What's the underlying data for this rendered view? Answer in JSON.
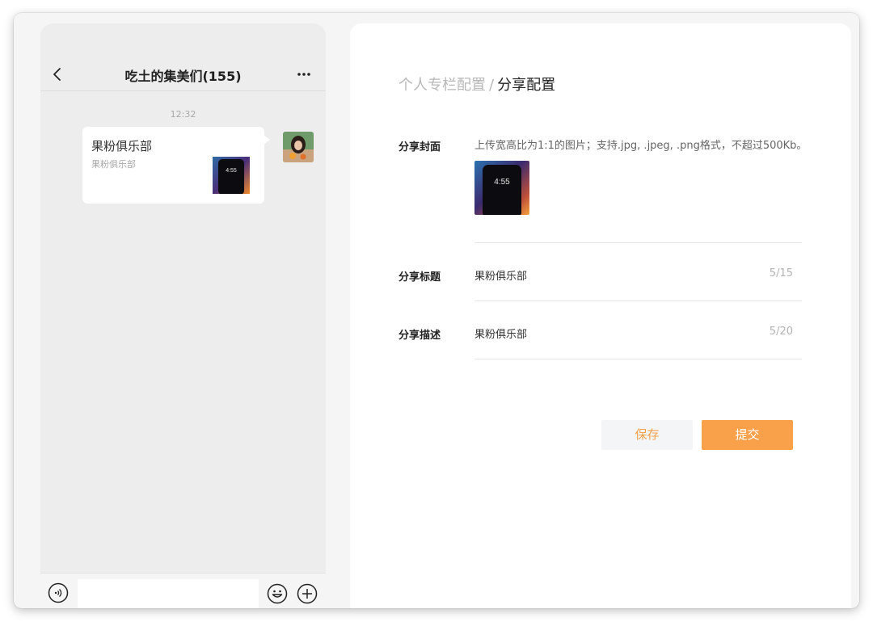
{
  "colors": {
    "accent": "#f8a04a",
    "save_text": "#f3a14a",
    "chat_bg": "#ededed",
    "panel_bg": "#ffffff"
  },
  "chat": {
    "title": "吃土的集美们(155)",
    "time": "12:32",
    "card": {
      "title": "果粉俱乐部",
      "desc": "果粉俱乐部",
      "thumb_clock": "4:55"
    }
  },
  "panel": {
    "breadcrumb": {
      "prev": "个人专栏配置",
      "sep": "/",
      "current": "分享配置"
    },
    "cover": {
      "label": "分享封面",
      "hint": "上传宽高比为1:1的图片；支持.jpg, .jpeg, .png格式，不超过500Kb。",
      "clock": "4:55"
    },
    "title_field": {
      "label": "分享标题",
      "value": "果粉俱乐部",
      "count": "5/15"
    },
    "desc_field": {
      "label": "分享描述",
      "value": "果粉俱乐部",
      "count": "5/20"
    },
    "buttons": {
      "save": "保存",
      "submit": "提交"
    }
  }
}
